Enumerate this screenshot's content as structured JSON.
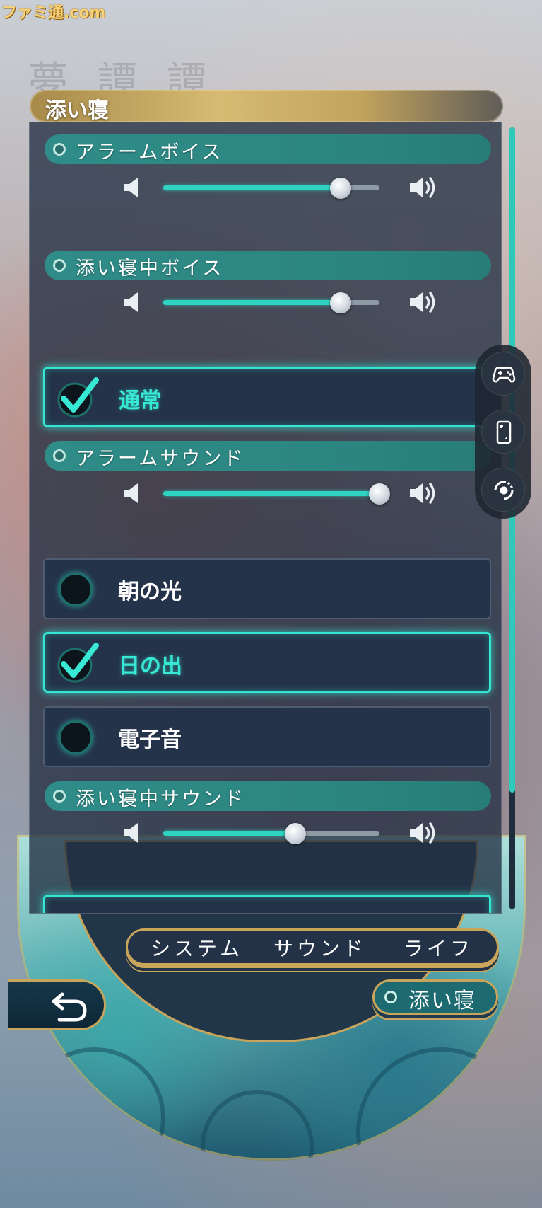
{
  "watermark": "ファミ通.com",
  "ghost_title": "夢 譚 譚",
  "header": {
    "title": "添い寝"
  },
  "sections": {
    "alarm_voice": "アラームボイス",
    "sleep_voice": "添い寝中ボイス",
    "alarm_sound": "アラームサウンド",
    "sleep_sound": "添い寝中サウンド"
  },
  "sliders": {
    "alarm_voice": 0.82,
    "sleep_voice": 0.82,
    "alarm_sound": 1.0,
    "sleep_sound": 0.61
  },
  "voice_options": [
    {
      "label": "通常",
      "selected": true
    }
  ],
  "sound_options": [
    {
      "label": "朝の光",
      "selected": false
    },
    {
      "label": "日の出",
      "selected": true
    },
    {
      "label": "電子音",
      "selected": false
    }
  ],
  "tabs": {
    "system": "システム",
    "sound": "サウンド",
    "life": "ライフ"
  },
  "subtab": {
    "label": "添い寝"
  },
  "icons": {
    "speaker_low": "speaker-low-icon",
    "speaker_high": "speaker-high-icon",
    "gamepad": "gamepad-icon",
    "phone": "phone-rotate-icon",
    "record": "record-icon",
    "back": "back-arrow-icon",
    "check": "check-icon"
  },
  "colors": {
    "accent": "#33e6d2",
    "gold": "#c8a55a",
    "panel": "#223042"
  }
}
